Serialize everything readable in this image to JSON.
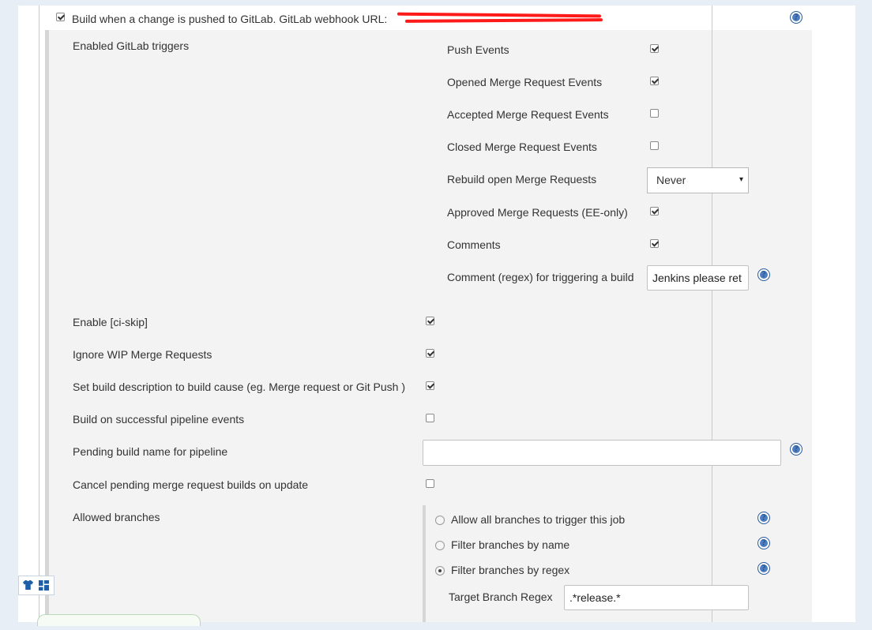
{
  "header": {
    "build_on_push_label": "Build when a change is pushed to GitLab. GitLab webhook URL:",
    "build_on_push_checked": true
  },
  "triggers": {
    "section_label": "Enabled GitLab triggers",
    "push_events": {
      "label": "Push Events",
      "checked": true
    },
    "opened_mr_events": {
      "label": "Opened Merge Request Events",
      "checked": true
    },
    "accepted_mr_events": {
      "label": "Accepted Merge Request Events",
      "checked": false
    },
    "closed_mr_events": {
      "label": "Closed Merge Request Events",
      "checked": false
    },
    "rebuild_open_mr": {
      "label": "Rebuild open Merge Requests",
      "selected": "Never"
    },
    "approved_mr": {
      "label": "Approved Merge Requests (EE-only)",
      "checked": true
    },
    "comments": {
      "label": "Comments",
      "checked": true
    },
    "comment_regex": {
      "label": "Comment (regex) for triggering a build",
      "value": "Jenkins please ret"
    }
  },
  "options": {
    "ci_skip": {
      "label": "Enable [ci-skip]",
      "checked": true
    },
    "ignore_wip": {
      "label": "Ignore WIP Merge Requests",
      "checked": true
    },
    "set_build_description": {
      "label": "Set build description to build cause (eg. Merge request or Git Push )",
      "checked": true
    },
    "build_on_pipeline": {
      "label": "Build on successful pipeline events",
      "checked": false
    },
    "pending_build_name": {
      "label": "Pending build name for pipeline",
      "value": ""
    },
    "cancel_pending": {
      "label": "Cancel pending merge request builds on update",
      "checked": false
    }
  },
  "branches": {
    "section_label": "Allowed branches",
    "allow_all": {
      "label": "Allow all branches to trigger this job",
      "selected": false
    },
    "filter_by_name": {
      "label": "Filter branches by name",
      "selected": false
    },
    "filter_by_regex": {
      "label": "Filter branches by regex",
      "selected": true
    },
    "target_branch_regex": {
      "label": "Target Branch Regex",
      "value": ".*release.*"
    }
  },
  "icons": {
    "help": "help-icon",
    "help_glyph": "?",
    "dropdown_arrow": "▾",
    "tshirt": "tshirt-icon",
    "grid": "grid-icon"
  },
  "colors": {
    "help_blue": "#4d7ec0",
    "panel_bg": "#f3f3f3",
    "redaction_red": "#ff1a1a"
  }
}
